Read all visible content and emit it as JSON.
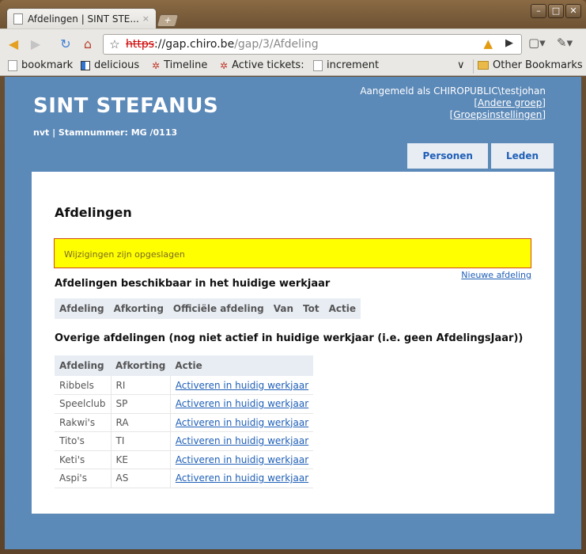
{
  "browser": {
    "tab_title": "Afdelingen | SINT STE...",
    "tab_close": "×",
    "newtab": "+",
    "url_scheme": "https",
    "url_host": "://gap.chiro.be",
    "url_path": "/gap/3/Afdeling",
    "win_minimize": "–",
    "win_maximize": "□",
    "win_close": "✕",
    "bookmarks": [
      {
        "label": "bookmark",
        "icon": "page-icon"
      },
      {
        "label": "delicious",
        "icon": "delicious-icon"
      },
      {
        "label": "Timeline",
        "icon": "bug-icon"
      },
      {
        "label": "Active tickets:",
        "icon": "bug-icon"
      },
      {
        "label": "increment",
        "icon": "page-icon"
      }
    ],
    "other_bookmarks": "Other Bookmarks"
  },
  "site": {
    "title": "SINT STEFANUS",
    "subtitle": "nvt | Stamnummer: MG /0113",
    "logged_in": "Aangemeld als CHIROPUBLIC\\testjohan",
    "link_other_group": "[Andere groep]",
    "link_group_settings": "[Groepsinstellingen]",
    "nav": [
      "Personen",
      "Leden"
    ]
  },
  "main": {
    "heading": "Afdelingen",
    "flash": "Wijzigingen zijn opgeslagen",
    "new_link": "Nieuwe afdeling",
    "section1_title": "Afdelingen beschikbaar in het huidige werkjaar",
    "table1_headers": [
      "Afdeling",
      "Afkorting",
      "Officiële afdeling",
      "Van",
      "Tot",
      "Actie"
    ],
    "section2_title": "Overige afdelingen (nog niet actief in huidige werkjaar (i.e. geen AfdelingsJaar))",
    "table2_headers": [
      "Afdeling",
      "Afkorting",
      "Actie"
    ],
    "table2_rows": [
      [
        "Ribbels",
        "RI",
        "Activeren in huidig werkjaar"
      ],
      [
        "Speelclub",
        "SP",
        "Activeren in huidig werkjaar"
      ],
      [
        "Rakwi's",
        "RA",
        "Activeren in huidig werkjaar"
      ],
      [
        "Tito's",
        "TI",
        "Activeren in huidig werkjaar"
      ],
      [
        "Keti's",
        "KE",
        "Activeren in huidig werkjaar"
      ],
      [
        "Aspi's",
        "AS",
        "Activeren in huidig werkjaar"
      ]
    ]
  }
}
